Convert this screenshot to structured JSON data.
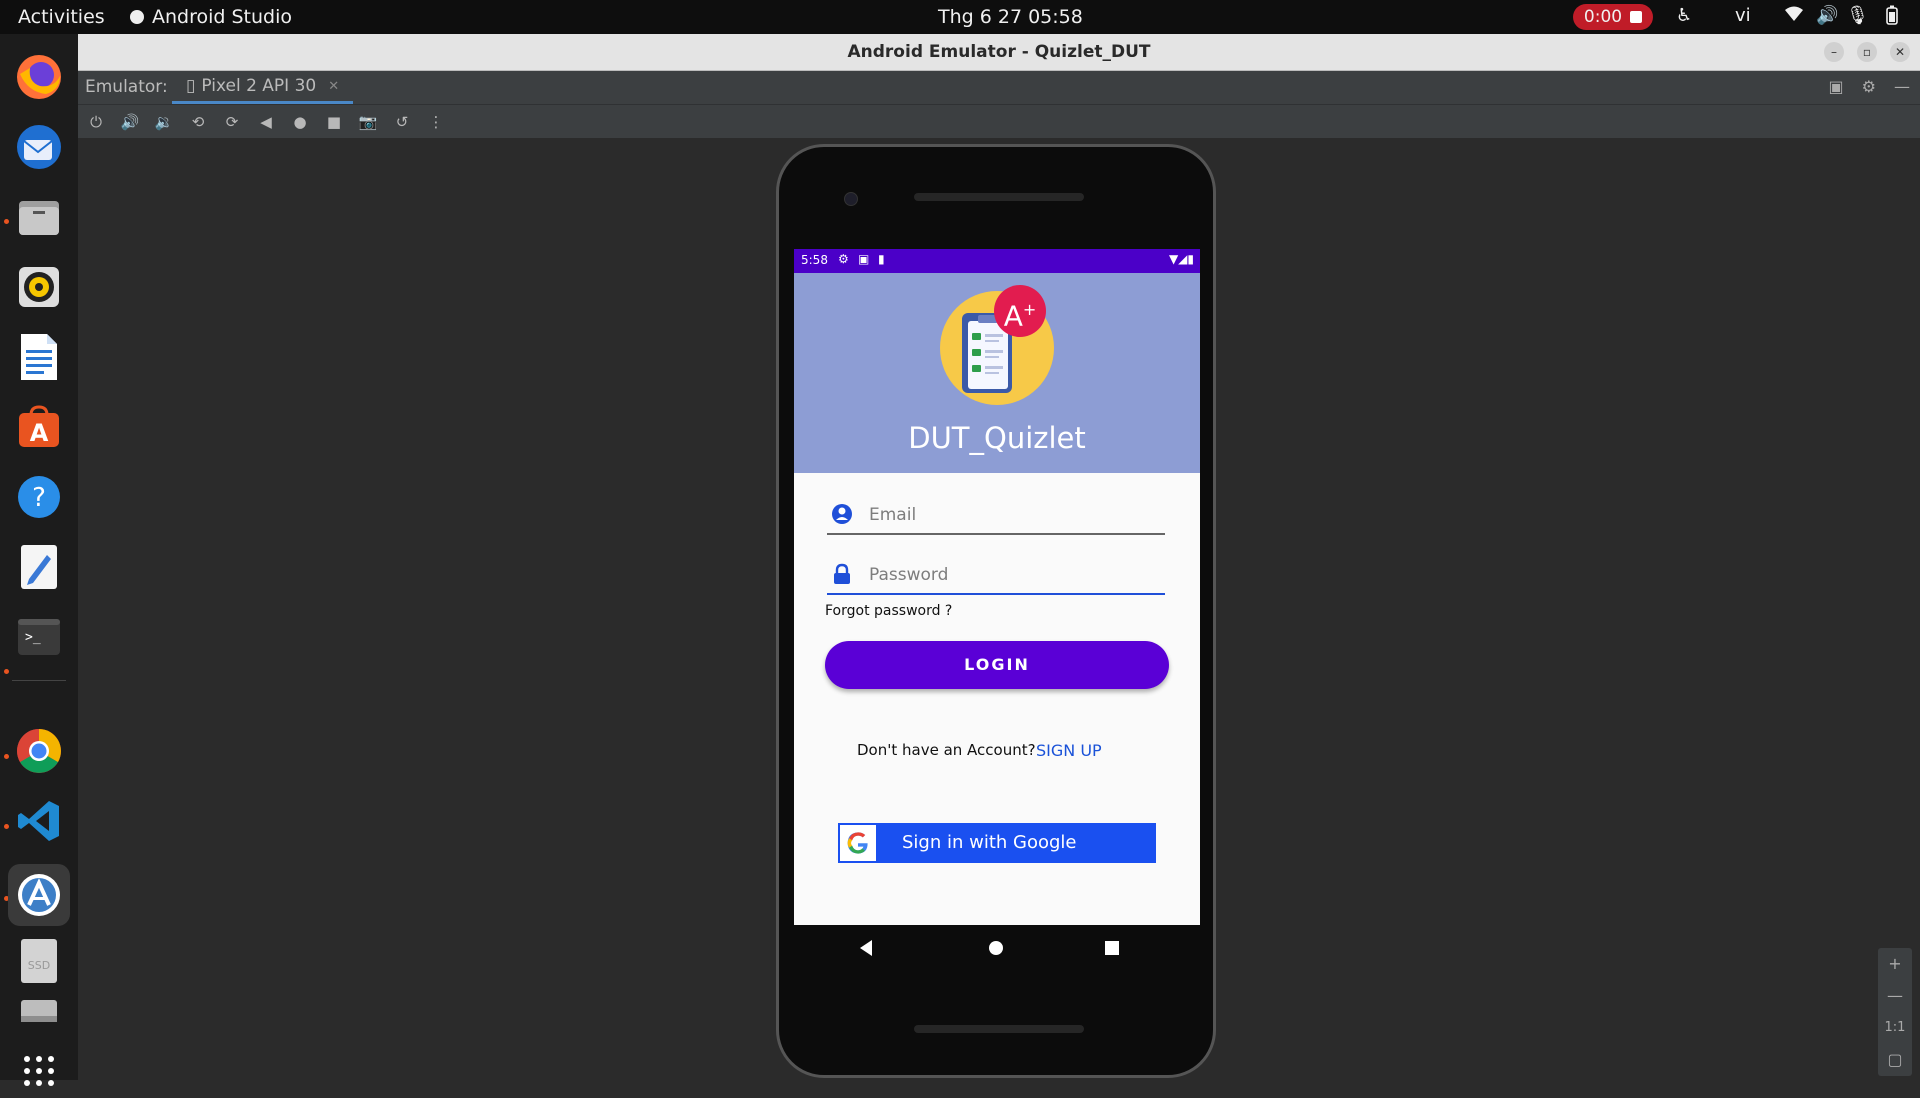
{
  "topbar": {
    "activities": "Activities",
    "app_name": "Android Studio",
    "clock": "Thg 6 27  05:58",
    "record_time": "0:00",
    "language": "vi"
  },
  "window": {
    "title": "Android Emulator - Quizlet_DUT"
  },
  "tabbar": {
    "label": "Emulator:",
    "device_tab": "Pixel 2 API 30"
  },
  "phone": {
    "status_time": "5:58",
    "app_title": "DUT_Quizlet",
    "email_placeholder": "Email",
    "password_placeholder": "Password",
    "forgot_password": "Forgot password ?",
    "login_button": "LOGIN",
    "no_account": "Don't have an Account?",
    "sign_up": "SIGN UP",
    "google_button": "Sign in with Google"
  },
  "zoom": {
    "plus": "+",
    "minus": "—",
    "one_to_one": "1:1"
  },
  "colors": {
    "status_bar": "#4b00c8",
    "header": "#8d9dd4",
    "login_button": "#5a00d6",
    "google_button": "#1a50f0",
    "recording_badge": "#c01c28"
  },
  "icons": {
    "dock": [
      "firefox-icon",
      "thunderbird-icon",
      "files-icon",
      "rhythmbox-icon",
      "writer-icon",
      "app-center-icon",
      "help-icon",
      "text-editor-icon",
      "terminal-icon",
      "chrome-icon",
      "vscode-icon",
      "android-studio-icon",
      "ssd-icon",
      "drive-icon",
      "show-apps-icon"
    ],
    "toolbar": [
      "power-icon",
      "volume-up-icon",
      "volume-down-icon",
      "rotate-left-icon",
      "rotate-right-icon",
      "back-icon",
      "home-icon",
      "overview-icon",
      "screenshot-icon",
      "snapshot-icon",
      "more-icon"
    ]
  }
}
